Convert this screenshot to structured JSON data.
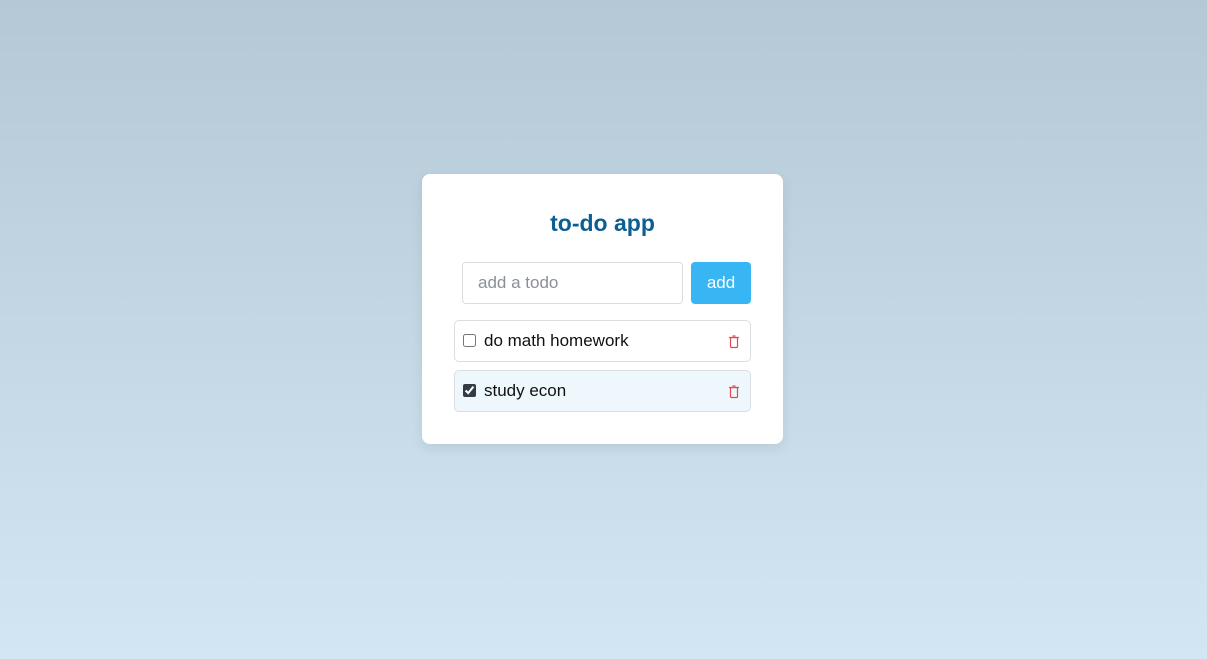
{
  "app": {
    "title": "to-do app"
  },
  "form": {
    "input_placeholder": "add a todo",
    "input_value": "",
    "add_label": "add"
  },
  "todos": [
    {
      "text": "do math homework",
      "completed": false
    },
    {
      "text": "study econ",
      "completed": true
    }
  ],
  "icons": {
    "delete": "trash-icon"
  },
  "colors": {
    "title": "#0c5f93",
    "accent_button": "#38b6f4",
    "delete_icon": "#e5484d",
    "completed_row_bg": "#eef7fc"
  }
}
